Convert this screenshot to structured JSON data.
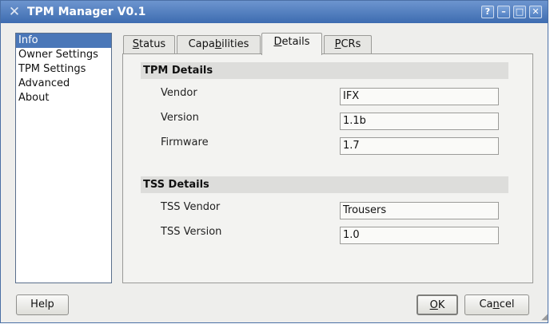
{
  "window": {
    "title": "TPM Manager V0.1",
    "icon": "x-icon",
    "controls": [
      {
        "name": "help",
        "label": "?"
      },
      {
        "name": "minimize",
        "label": "–"
      },
      {
        "name": "maximize",
        "label": "□"
      },
      {
        "name": "close",
        "label": "✕"
      }
    ]
  },
  "sidebar": {
    "items": [
      {
        "label": "Info",
        "selected": true
      },
      {
        "label": "Owner Settings",
        "selected": false
      },
      {
        "label": "TPM Settings",
        "selected": false
      },
      {
        "label": "Advanced",
        "selected": false
      },
      {
        "label": "About",
        "selected": false
      }
    ]
  },
  "tabs": [
    {
      "label": "Status",
      "mnemonic": "S",
      "rest": "tatus",
      "active": false
    },
    {
      "label": "Capabilities",
      "mnemonic_prefix": "Capa",
      "mnemonic": "b",
      "rest": "ilities",
      "active": false
    },
    {
      "label": "Details",
      "mnemonic": "D",
      "rest": "etails",
      "active": true
    },
    {
      "label": "PCRs",
      "mnemonic": "P",
      "rest": "CRs",
      "active": false
    }
  ],
  "details": {
    "tpm_header": "TPM Details",
    "tpm_fields": [
      {
        "label": "Vendor",
        "value": "IFX"
      },
      {
        "label": "Version",
        "value": "1.1b"
      },
      {
        "label": "Firmware",
        "value": "1.7"
      }
    ],
    "tss_header": "TSS Details",
    "tss_fields": [
      {
        "label": "TSS Vendor",
        "value": "Trousers"
      },
      {
        "label": "TSS Version",
        "value": "1.0"
      }
    ]
  },
  "buttons": {
    "help": "Help",
    "ok_mnemonic": "O",
    "ok_rest": "K",
    "cancel_prefix": "Ca",
    "cancel_mnemonic": "n",
    "cancel_rest": "cel"
  },
  "colors": {
    "titlebar": "#3d6cb0",
    "selection": "#4a77b8",
    "section_header_bg": "#dddddb"
  }
}
